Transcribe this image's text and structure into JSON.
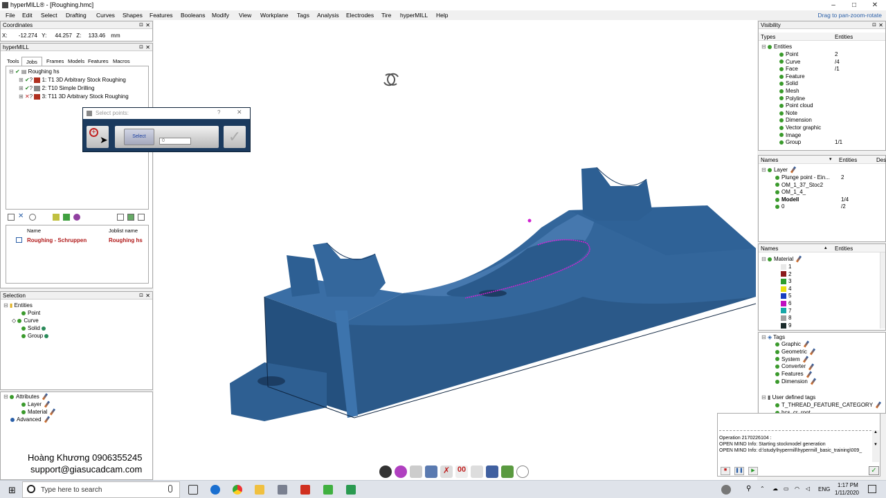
{
  "window": {
    "title": "hyperMILL® - [Roughing.hmc]",
    "controls": [
      "–",
      "□",
      "✕"
    ]
  },
  "menu": {
    "items": [
      "File",
      "Edit",
      "Select",
      "Drafting",
      "Curves",
      "Shapes",
      "Features",
      "Booleans",
      "Modify",
      "View",
      "Workplane",
      "Tags",
      "Analysis",
      "Electrodes",
      "Tire",
      "hyperMILL",
      "Help"
    ],
    "hint": "Drag to pan-zoom-rotate"
  },
  "coordinates": {
    "title": "Coordinates",
    "x_label": "X:",
    "x": "-12.274",
    "y_label": "Y:",
    "y": "44.257",
    "z_label": "Z:",
    "z": "133.46",
    "unit": "mm"
  },
  "hypermill_panel": {
    "title": "hyperMILL",
    "tabs": [
      "Tools",
      "Jobs",
      "Frames",
      "Models",
      "Features",
      "Macros"
    ],
    "active_tab": "Jobs",
    "root": "Roughing hs",
    "jobs": [
      "1: T1 3D Arbitrary Stock Roughing",
      "2: T10 Simple Drilling",
      "3: T11 3D Arbitrary Stock Roughing"
    ],
    "list_headers": [
      "Name",
      "Joblist name"
    ],
    "list_rows": [
      {
        "name": "Roughing - Schruppen",
        "joblist": "Roughing hs"
      }
    ]
  },
  "select_dialog": {
    "title": "Select points:",
    "help": "?",
    "select_label": "Select",
    "count_value": "0"
  },
  "selection_panel": {
    "title": "Selection",
    "root": "Entities",
    "items": [
      "Point",
      "Curve",
      "Solid",
      "Group"
    ]
  },
  "attributes_panel": {
    "root": "Attributes",
    "items": [
      "Layer",
      "Material"
    ],
    "advanced": "Advanced"
  },
  "watermark": {
    "line1": "Hoàng Khương 0906355245",
    "line2": "support@giasucadcam.com"
  },
  "visibility_panel": {
    "title": "Visibility",
    "col_types": "Types",
    "col_entities": "Entities",
    "root": "Entities",
    "rows": [
      {
        "name": "Point",
        "count": "2"
      },
      {
        "name": "Curve",
        "count": "/4"
      },
      {
        "name": "Face",
        "count": "/1"
      },
      {
        "name": "Feature",
        "count": ""
      },
      {
        "name": "Solid",
        "count": ""
      },
      {
        "name": "Mesh",
        "count": ""
      },
      {
        "name": "Polyline",
        "count": ""
      },
      {
        "name": "Point cloud",
        "count": ""
      },
      {
        "name": "Note",
        "count": ""
      },
      {
        "name": "Dimension",
        "count": ""
      },
      {
        "name": "Vector graphic",
        "count": ""
      },
      {
        "name": "Image",
        "count": ""
      },
      {
        "name": "Group",
        "count": "1/1"
      }
    ]
  },
  "layers_panel": {
    "col_names": "Names",
    "col_entities": "Entities",
    "col_des": "Des",
    "root": "Layer",
    "rows": [
      {
        "name": "Plunge point - Ein...",
        "count": "2"
      },
      {
        "name": "OM_1_37_Stoc2",
        "count": ""
      },
      {
        "name": "OM_1_4_",
        "count": ""
      },
      {
        "name": "Modell",
        "count": "1/4"
      },
      {
        "name": "0",
        "count": "/2"
      }
    ]
  },
  "material_panel": {
    "col_names": "Names",
    "col_entities": "Entities",
    "root": "Material",
    "rows": [
      {
        "name": "1",
        "color": "#e8e8e8"
      },
      {
        "name": "2",
        "color": "#8b1a1a"
      },
      {
        "name": "3",
        "color": "#2e9e2e"
      },
      {
        "name": "4",
        "color": "#e8e010"
      },
      {
        "name": "5",
        "color": "#1a3fc0"
      },
      {
        "name": "6",
        "color": "#c010c0"
      },
      {
        "name": "7",
        "color": "#18a8a8"
      },
      {
        "name": "8",
        "color": "#a0a0a0"
      },
      {
        "name": "9",
        "color": "#1a2a2a"
      }
    ]
  },
  "tags_panel": {
    "root": "Tags",
    "items": [
      "Graphic",
      "Geometric",
      "System",
      "Converter",
      "Features",
      "Dimension"
    ],
    "user_root": "User defined tags",
    "user_items": [
      "T_THREAD_FEATURE_CATEGORY",
      "hcs_cr_root"
    ]
  },
  "log_panel": {
    "lines": [
      "Operation 2170226104 :",
      "OPEN MIND Info:     Starting stockmodel generation",
      "OPEN MIND Info:     d:\\study\\hypermill\\hypermill_basic_training\\009_"
    ]
  },
  "taskbar": {
    "search_placeholder": "Type here to search",
    "lang": "ENG",
    "time": "1:17 PM",
    "date": "1/11/2020"
  },
  "colors": {
    "model": "#2d5b8c",
    "model_dark": "#1c3d63",
    "accent": "#2a5fa8",
    "highlight": "#d020d0"
  }
}
